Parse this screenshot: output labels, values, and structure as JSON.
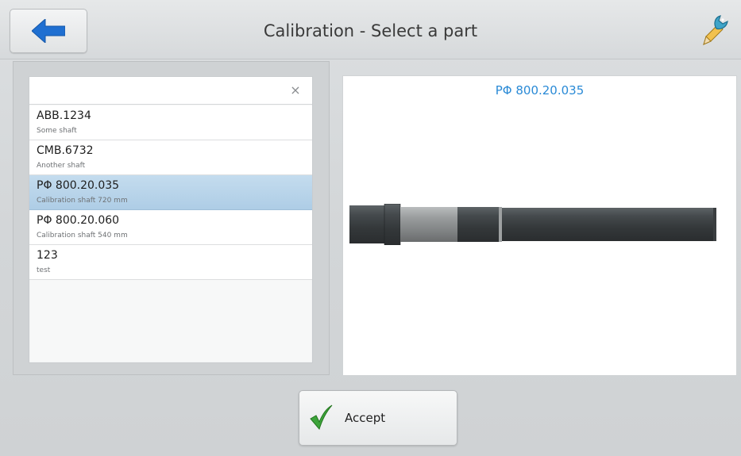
{
  "header": {
    "title": "Calibration - Select a part",
    "back_icon": "arrow-left-icon",
    "tool_icon": "wrench-pencil-icon",
    "accent": "#1f6fd1"
  },
  "search": {
    "value": "",
    "placeholder": "",
    "clear_symbol": "×"
  },
  "parts": [
    {
      "code": "ABB.1234",
      "description": "Some shaft",
      "selected": false
    },
    {
      "code": "CMB.6732",
      "description": "Another shaft",
      "selected": false
    },
    {
      "code": "PΦ 800.20.035",
      "description": "Calibration shaft 720 mm",
      "selected": true
    },
    {
      "code": "PΦ 800.20.060",
      "description": "Calibration shaft 540 mm",
      "selected": false
    },
    {
      "code": "123",
      "description": "test",
      "selected": false
    }
  ],
  "preview": {
    "title": "PΦ 800.20.035",
    "title_color": "#2a8ad6"
  },
  "footer": {
    "accept_label": "Accept",
    "accept_icon": "checkmark-icon"
  }
}
